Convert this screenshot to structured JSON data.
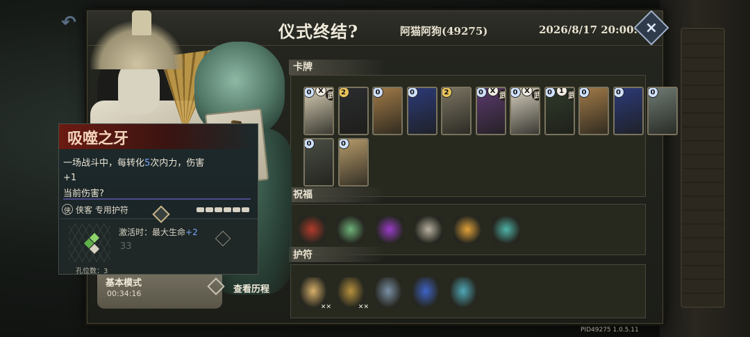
{
  "header": {
    "title": "仪式终结?",
    "player": "阿猫阿狗(49275)",
    "datetime": "2026/8/17 20:00:02",
    "close_icon": "×",
    "back_icon": "↶"
  },
  "item_tooltip": {
    "name": "吸噬之牙",
    "desc_part1": "一场战斗中，每转化",
    "desc_highlight": "5",
    "desc_part2": "次内力，伤害",
    "desc_plus": "+1",
    "current_damage": "当前伤害?",
    "type": "侠客 专用护符",
    "type_icon": "侠",
    "activation_text": "激活时：最大生命",
    "activation_bonus": "+2",
    "socket_number": "33",
    "holes": "孔位数：3",
    "star_count": 6
  },
  "mode": {
    "label": "基本模式",
    "time": "00:34:16",
    "history_label": "查看历程"
  },
  "sections": {
    "cards": "卡牌",
    "blessings": "祝福",
    "amulets": "护符"
  },
  "cards": [
    {
      "name": "card-white-fist",
      "cost": "0",
      "x_mark": "X",
      "wu": "武",
      "color": "#d8cfb5"
    },
    {
      "name": "card-shadow-beast",
      "cost": "2",
      "x_mark": "",
      "wu": "",
      "color": "#2a2c2e"
    },
    {
      "name": "card-spear",
      "cost": "0",
      "x_mark": "",
      "wu": "",
      "color": "#a07a48"
    },
    {
      "name": "card-spellbook",
      "cost": "0",
      "x_mark": "",
      "wu": "",
      "color": "#2c3a78"
    },
    {
      "name": "card-twin-warriors",
      "cost": "2",
      "x_mark": "",
      "wu": "",
      "color": "#7b7462"
    },
    {
      "name": "card-purple-strike",
      "cost": "0",
      "x_mark": "X",
      "wu": "武",
      "color": "#5a3a6e"
    },
    {
      "name": "card-white-strike",
      "cost": "0",
      "x_mark": "X",
      "wu": "武",
      "color": "#d6cfbe"
    },
    {
      "name": "card-dark-warrior",
      "cost": "0",
      "x_mark": "1",
      "wu": "武",
      "color": "#2f3a2a"
    },
    {
      "name": "card-spear-2",
      "cost": "0",
      "x_mark": "",
      "wu": "",
      "color": "#a07a48"
    },
    {
      "name": "card-spellbook-2",
      "cost": "0",
      "x_mark": "",
      "wu": "",
      "color": "#2c3a78"
    },
    {
      "name": "card-white-crane",
      "cost": "0",
      "x_mark": "",
      "wu": "",
      "color": "#6e7a72"
    },
    {
      "name": "card-dark-serpent",
      "cost": "0",
      "x_mark": "",
      "wu": "",
      "color": "#4a4e44"
    },
    {
      "name": "card-golden-beast",
      "cost": "0",
      "x_mark": "",
      "wu": "",
      "color": "#b59a6a"
    }
  ],
  "card_badge_colors": {
    "cost_blue": "#cfe1ff",
    "cost_gold": "#e7c25a"
  },
  "blessings": [
    {
      "name": "heart-card-icon",
      "color": "#b23a2a"
    },
    {
      "name": "masked-figure-icon",
      "color": "#6fb37a"
    },
    {
      "name": "purple-flame-icon",
      "color": "#9a3cc8"
    },
    {
      "name": "scroll-bundle-icon",
      "color": "#b8b1a0"
    },
    {
      "name": "golden-dragon-icon",
      "color": "#e2a23a"
    },
    {
      "name": "hooded-ghost-icon",
      "color": "#4fb3a8"
    }
  ],
  "amulets": [
    {
      "name": "fang-amulet-icon",
      "color": "#d8b06a",
      "mark": "✕✕"
    },
    {
      "name": "golden-scroll-amulet-icon",
      "color": "#b8913e",
      "mark": "✕✕"
    },
    {
      "name": "lantern-amulet-icon",
      "color": "#7a8fa6",
      "mark": ""
    },
    {
      "name": "blue-crystal-amulet-icon",
      "color": "#3f63c8",
      "mark": ""
    },
    {
      "name": "teal-feather-amulet-icon",
      "color": "#4fa8b8",
      "mark": ""
    }
  ],
  "footer": "PID49275  1.0.5.11"
}
